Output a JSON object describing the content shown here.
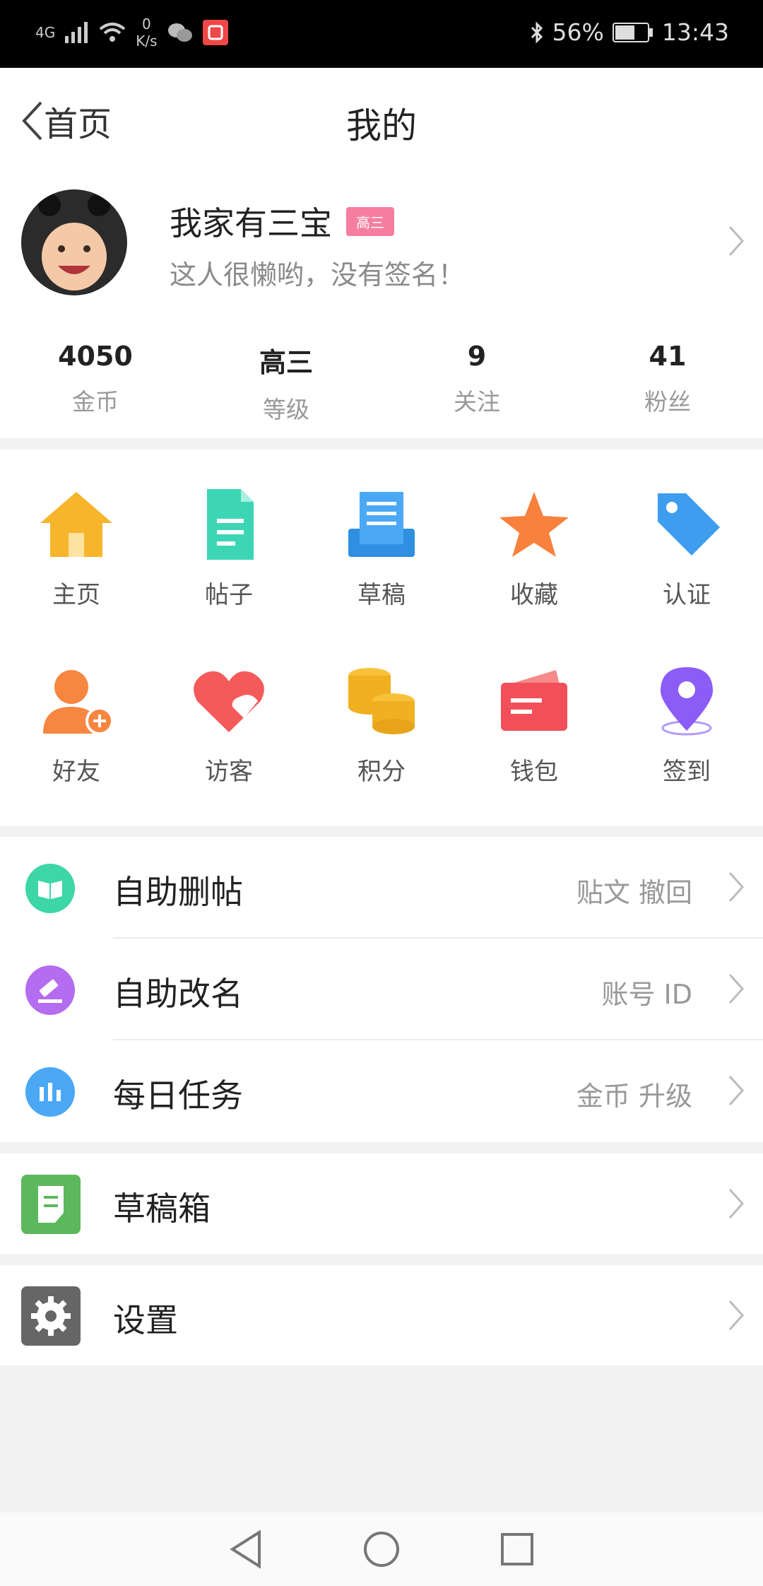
{
  "status_bar": {
    "network": "4G",
    "speed_value": "0",
    "speed_unit": "K/s",
    "battery": "56%",
    "time": "13:43"
  },
  "header": {
    "back_label": "首页",
    "title": "我的"
  },
  "profile": {
    "username": "我家有三宝",
    "level_badge": "高三",
    "signature": "这人很懒哟，没有签名！"
  },
  "stats": [
    {
      "value": "4050",
      "label": "金币"
    },
    {
      "value": "高三",
      "label": "等级"
    },
    {
      "value": "9",
      "label": "关注"
    },
    {
      "value": "41",
      "label": "粉丝"
    }
  ],
  "grid": [
    {
      "label": "主页",
      "icon": "home-icon"
    },
    {
      "label": "帖子",
      "icon": "post-icon"
    },
    {
      "label": "草稿",
      "icon": "draft-icon"
    },
    {
      "label": "收藏",
      "icon": "star-icon"
    },
    {
      "label": "认证",
      "icon": "tag-icon"
    },
    {
      "label": "好友",
      "icon": "add-friend-icon"
    },
    {
      "label": "访客",
      "icon": "visitor-heart-icon"
    },
    {
      "label": "积分",
      "icon": "coins-icon"
    },
    {
      "label": "钱包",
      "icon": "wallet-icon"
    },
    {
      "label": "签到",
      "icon": "location-pin-icon"
    }
  ],
  "menu_group1": [
    {
      "label": "自助删帖",
      "sub": "贴文  撤回",
      "icon": "book-icon",
      "color": "#3dd6a6"
    },
    {
      "label": "自助改名",
      "sub": "账号  ID",
      "icon": "gavel-icon",
      "color": "#b46cf0"
    },
    {
      "label": "每日任务",
      "sub": "金币  升级",
      "icon": "chart-icon",
      "color": "#4aa8f5"
    }
  ],
  "menu_drafts": {
    "label": "草稿箱",
    "icon": "draft-box-icon",
    "color": "#5cb85c"
  },
  "menu_settings": {
    "label": "设置",
    "icon": "settings-gear-icon",
    "color": "#666666"
  }
}
